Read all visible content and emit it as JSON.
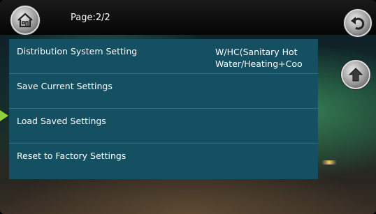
{
  "header": {
    "page_label": "Page:2/2"
  },
  "menu": {
    "items": [
      {
        "label": "Distribution System Setting",
        "value_line1": "W/HC(Sanitary Hot",
        "value_line2": "Water/Heating+Coo"
      },
      {
        "label": "Save Current Settings"
      },
      {
        "label": "Load Saved Settings"
      },
      {
        "label": "Reset to Factory Settings"
      }
    ]
  },
  "icons": {
    "home": "home-icon",
    "back": "back-arrow-icon",
    "scroll_up": "up-arrow-icon"
  },
  "colors": {
    "menu_background": "#144f62",
    "menu_divider": "#2d6f82",
    "selection_pointer": "#8fd13a"
  }
}
